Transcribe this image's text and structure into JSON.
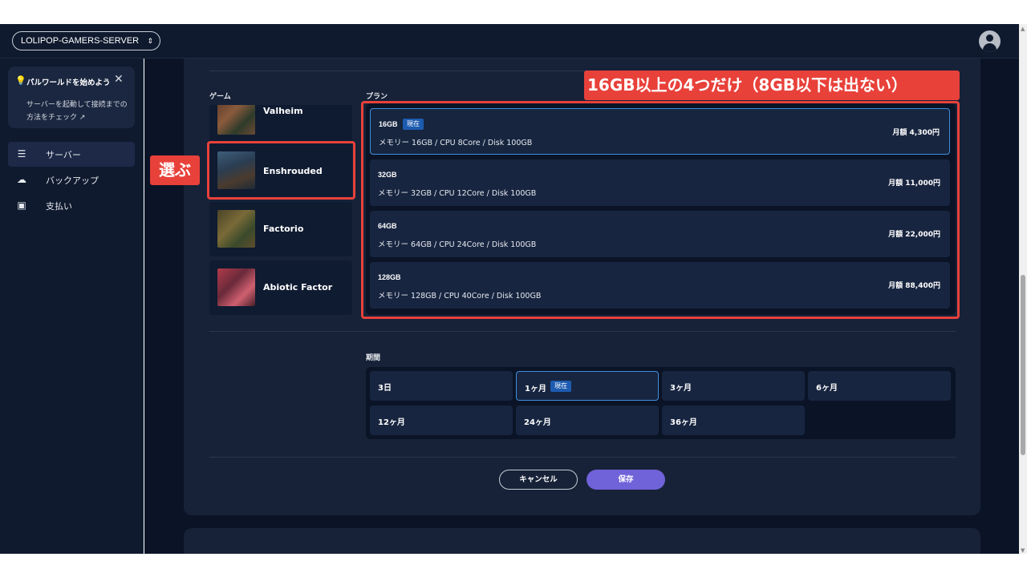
{
  "header": {
    "server_name": "LOLIPOP-GAMERS-SERVER",
    "server_select_arrows": "⌃⌄",
    "avatar_icon": "user-circle-icon"
  },
  "sidebar": {
    "wizard": {
      "title": "パルワールドを始めよう",
      "description": "サーバーを起動して接続までの方法をチェック",
      "ext_icon": "↗"
    },
    "items": [
      {
        "label": "サーバー",
        "icon": "server-icon",
        "active": true
      },
      {
        "label": "バックアップ",
        "icon": "cloud-upload-icon",
        "active": false
      },
      {
        "label": "支払い",
        "icon": "payment-icon",
        "active": false
      }
    ]
  },
  "form": {
    "game_label": "ゲーム",
    "plan_label": "プラン",
    "period_label": "期間",
    "games": [
      {
        "name": "Valheim"
      },
      {
        "name": "Enshrouded",
        "selected": true
      },
      {
        "name": "Factorio"
      },
      {
        "name": "Abiotic Factor"
      }
    ],
    "plans": [
      {
        "size": "16GB",
        "badge": "現在",
        "spec": "メモリー 16GB / CPU 8Core / Disk 100GB",
        "price": "月額  4,300円",
        "selected": true
      },
      {
        "size": "32GB",
        "badge": "",
        "spec": "メモリー 32GB / CPU 12Core / Disk 100GB",
        "price": "月額  11,000円",
        "selected": false
      },
      {
        "size": "64GB",
        "badge": "",
        "spec": "メモリー 64GB / CPU 24Core / Disk 100GB",
        "price": "月額  22,000円",
        "selected": false
      },
      {
        "size": "128GB",
        "badge": "",
        "spec": "メモリー 128GB / CPU 40Core / Disk 100GB",
        "price": "月額  88,400円",
        "selected": false
      }
    ],
    "periods": [
      {
        "label": "3日"
      },
      {
        "label": "1ヶ月",
        "badge": "現在",
        "selected": true
      },
      {
        "label": "3ヶ月"
      },
      {
        "label": "6ヶ月"
      },
      {
        "label": "12ヶ月"
      },
      {
        "label": "24ヶ月"
      },
      {
        "label": "36ヶ月"
      }
    ],
    "cancel_label": "キャンセル",
    "save_label": "保存"
  },
  "annotations": {
    "select_label": "選ぶ",
    "plans_note": "16GB以上の4つだけ（8GB以下は出ない）"
  },
  "colors": {
    "accent_purple": "#7062d8",
    "selected_border": "#3f8fe0",
    "badge_blue": "#1d5bb0",
    "annotation_red": "#e8413a"
  }
}
